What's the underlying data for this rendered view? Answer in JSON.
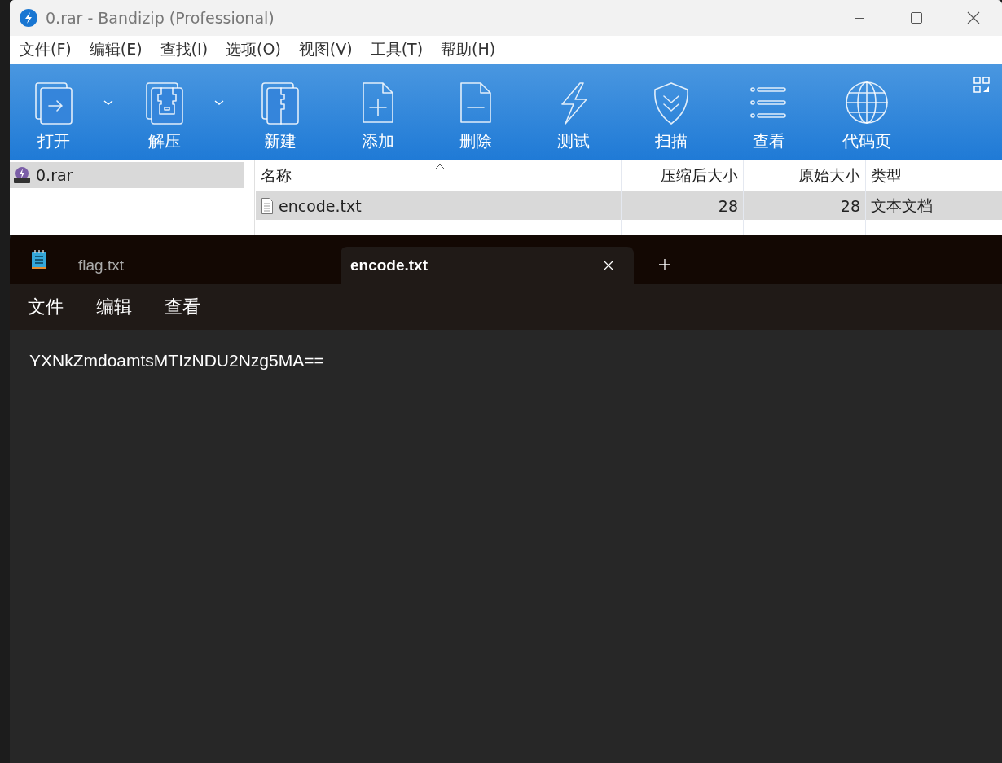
{
  "archiver": {
    "title": "0.rar - Bandizip (Professional)",
    "menu": [
      "文件(F)",
      "编辑(E)",
      "查找(I)",
      "选项(O)",
      "视图(V)",
      "工具(T)",
      "帮助(H)"
    ],
    "toolbar": [
      {
        "label": "打开",
        "has_menu": true
      },
      {
        "label": "解压",
        "has_menu": true
      },
      {
        "label": "新建",
        "has_menu": false
      },
      {
        "label": "添加",
        "has_menu": false
      },
      {
        "label": "删除",
        "has_menu": false
      },
      {
        "label": "测试",
        "has_menu": false
      },
      {
        "label": "扫描",
        "has_menu": false
      },
      {
        "label": "查看",
        "has_menu": false
      },
      {
        "label": "代码页",
        "has_menu": false
      }
    ],
    "tree": [
      {
        "label": "0.rar",
        "selected": true
      }
    ],
    "columns": [
      "名称",
      "压缩后大小",
      "原始大小",
      "类型"
    ],
    "rows": [
      {
        "cells": [
          "encode.txt",
          "28",
          "28",
          "文本文档"
        ],
        "selected": true
      }
    ]
  },
  "notepad": {
    "tabs": [
      {
        "label": "flag.txt",
        "selected": false
      },
      {
        "label": "encode.txt",
        "selected": true
      }
    ],
    "menu": [
      "文件",
      "编辑",
      "查看"
    ],
    "text": "YXNkZmdoamtsMTIzNDU2Nzg5MA=="
  }
}
